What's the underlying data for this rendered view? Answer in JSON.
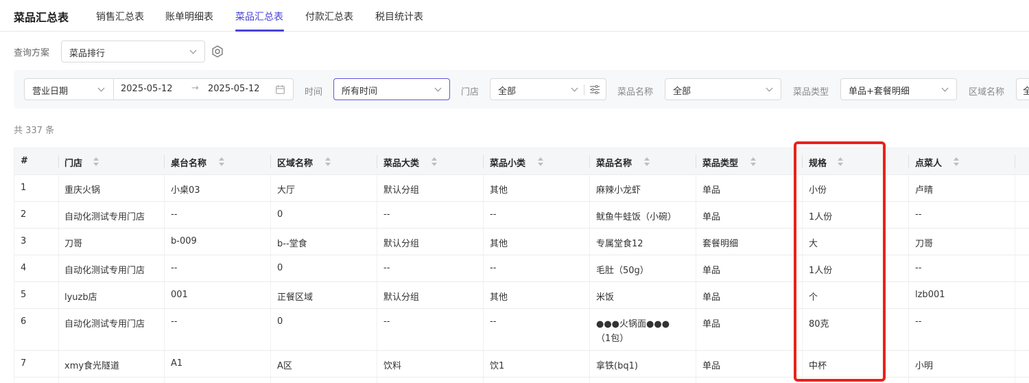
{
  "header": {
    "title": "菜品汇总表",
    "tabs": [
      {
        "label": "销售汇总表",
        "active": false
      },
      {
        "label": "账单明细表",
        "active": false
      },
      {
        "label": "菜品汇总表",
        "active": true
      },
      {
        "label": "付款汇总表",
        "active": false
      },
      {
        "label": "税目统计表",
        "active": false
      }
    ]
  },
  "query_scheme": {
    "label": "查询方案",
    "value": "菜品排行",
    "settings_icon": "gear-icon"
  },
  "filters": {
    "date_type": "营业日期",
    "date_start": "2025-05-12",
    "date_arrow": "→",
    "date_end": "2025-05-12",
    "time_label": "时间",
    "time_value": "所有时间",
    "store_label": "门店",
    "store_value": "全部",
    "dish_name_label": "菜品名称",
    "dish_name_value": "全部",
    "dish_type_label": "菜品类型",
    "dish_type_value": "单品+套餐明细",
    "area_label": "区域名称",
    "area_value": "全"
  },
  "summary": {
    "count_text": "共 337 条"
  },
  "table": {
    "columns": [
      "#",
      "门店",
      "桌台名称",
      "区域名称",
      "菜品大类",
      "菜品小类",
      "菜品名称",
      "菜品类型",
      "规格",
      "点菜人"
    ],
    "rows": [
      [
        "1",
        "重庆火锅",
        "小桌03",
        "大厅",
        "默认分组",
        "其他",
        "麻辣小龙虾",
        "单品",
        "小份",
        "卢晴"
      ],
      [
        "2",
        "自动化测试专用门店",
        "--",
        "0",
        "--",
        "--",
        "鱿鱼牛蛙饭（小碗）",
        "单品",
        "1人份",
        "--"
      ],
      [
        "3",
        "刀哥",
        "b-009",
        "b--堂食",
        "默认分组",
        "其他",
        "专属堂食12",
        "套餐明细",
        "大",
        "刀哥"
      ],
      [
        "4",
        "自动化测试专用门店",
        "--",
        "0",
        "--",
        "--",
        "毛肚（50g）",
        "单品",
        "1人份",
        "--"
      ],
      [
        "5",
        "lyuzb店",
        "001",
        "正餐区域",
        "默认分组",
        "其他",
        "米饭",
        "单品",
        "个",
        "lzb001"
      ],
      [
        "6",
        "自动化测试专用门店",
        "--",
        "0",
        "--",
        "--",
        "●●●火锅面●●●",
        "单品",
        "80克",
        "--"
      ],
      [
        "7",
        "xmy食光隧道",
        "A1",
        "A区",
        "饮料",
        "饮1",
        "拿铁(bq1)",
        "单品",
        "中杯",
        "小明"
      ]
    ],
    "row6_dish_line2": "（1包）"
  },
  "colors": {
    "accent": "#4a43d8",
    "highlight": "#e8231a"
  }
}
